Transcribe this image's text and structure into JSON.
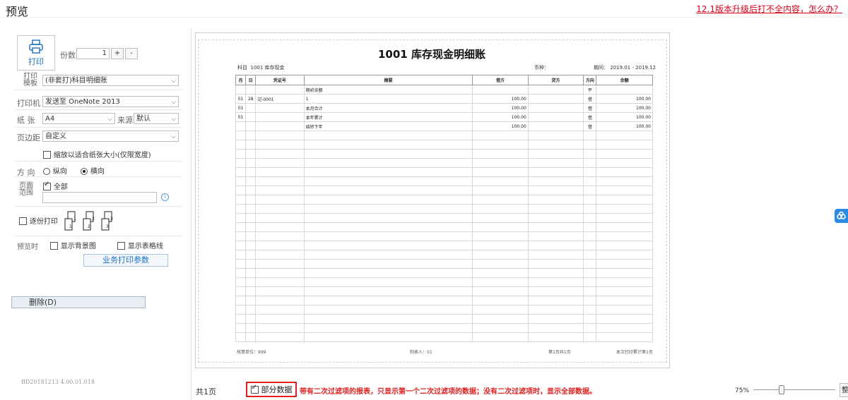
{
  "header": {
    "title": "预览",
    "help_link": "12.1版本升级后打不全内容，怎么办？"
  },
  "left_panel": {
    "print_label": "打印",
    "copies_label": "份数",
    "copies_value": "1",
    "plus": "+",
    "minus": "-",
    "template_label": "打印模板",
    "template_value": "(非套打)科目明细账",
    "printer_label": "打印机",
    "printer_value": "发送至 OneNote 2013",
    "paper_label": "纸 张",
    "paper_value": "A4",
    "source_label": "来源",
    "source_value": "默认",
    "margin_label": "页边距",
    "margin_value": "自定义",
    "fit_width_label": "缩放以适合纸张大小(仅限宽度)",
    "orientation_label": "方 向",
    "portrait_label": "纵向",
    "landscape_label": "横向",
    "range_label": "页面范围",
    "all_label": "全部",
    "collate_label": "逐份打印",
    "collate_pages": [
      "1",
      "2",
      "3"
    ],
    "preview_label": "预览时",
    "show_bg_label": "显示背景图",
    "show_grid_label": "显示表格线",
    "biz_params_button": "业务打印参数",
    "delete_button": "删除(D)",
    "version": "BD20181213 4.00.01.018"
  },
  "document": {
    "title": "1001 库存现金明细账",
    "subject_label": "科目",
    "subject_value": "1001 库存现金",
    "currency_label": "币种：",
    "period_label": "期间：",
    "period_value": "2019.01 - 2019.12",
    "columns": [
      "月",
      "日",
      "凭证号",
      "摘要",
      "借方",
      "贷方",
      "方向",
      "余额"
    ],
    "rows": [
      [
        "",
        "",
        "",
        "期初余额",
        "",
        "",
        "平",
        ""
      ],
      [
        "01",
        "28",
        "记-0001",
        "1",
        "100.00",
        "",
        "借",
        "100.00"
      ],
      [
        "01",
        "",
        "",
        "本月合计",
        "100.00",
        "",
        "借",
        "100.00"
      ],
      [
        "01",
        "",
        "",
        "本年累计",
        "100.00",
        "",
        "借",
        "100.00"
      ],
      [
        "",
        "",
        "",
        "结转下年",
        "100.00",
        "",
        "借",
        "100.00"
      ]
    ],
    "footer_left": "核算单位：999",
    "footer_mid": "制表人：01",
    "footer_page": "第1页共1页",
    "footer_right": "本次打印累计第1页"
  },
  "bottom": {
    "total_pages": "共1页",
    "partial_label": "部分数据",
    "notice": "带有二次过滤项的报表，只显示第一个二次过滤项的数据；没有二次过滤项时，显示全部数据。",
    "zoom": "75%",
    "fit_button": "整"
  },
  "colors": {
    "accent": "#1a6fc4",
    "alert": "#e02020",
    "cloud": "#2b8ce8"
  }
}
